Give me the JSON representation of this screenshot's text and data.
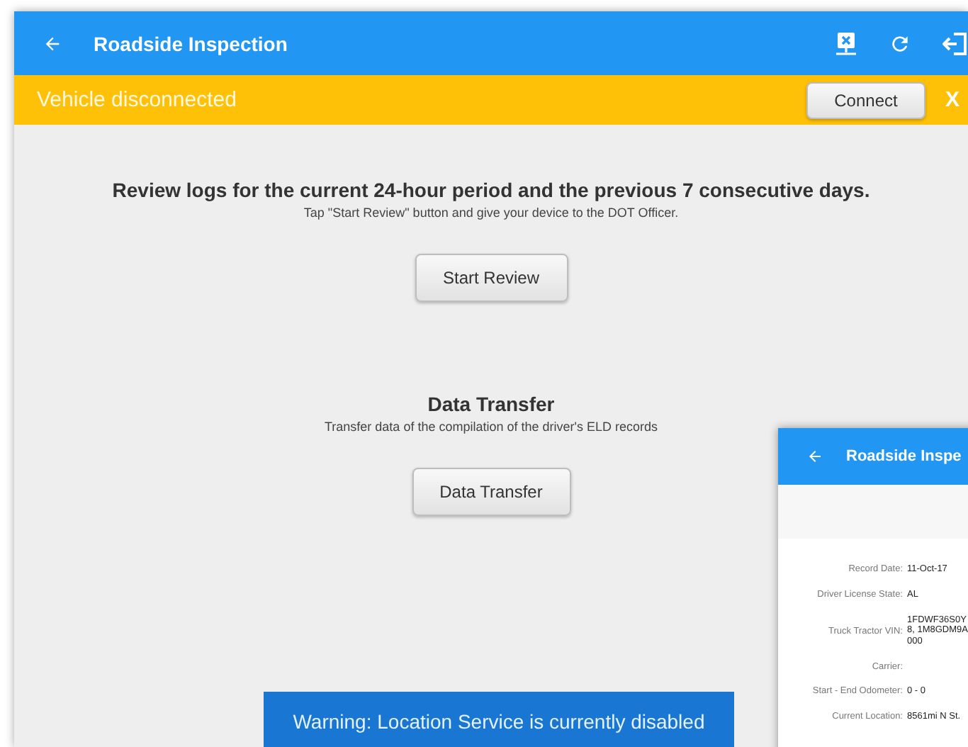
{
  "app_bar": {
    "title": "Roadside Inspection"
  },
  "alert_bar": {
    "message": "Vehicle disconnected",
    "action": "Connect",
    "dismiss": "X"
  },
  "review": {
    "heading": "Review logs for the current 24-hour period and the previous 7 consecutive days.",
    "hint": "Tap \"Start Review\" button and give your device to the DOT Officer.",
    "button": "Start Review"
  },
  "transfer": {
    "heading": "Data Transfer",
    "hint": "Transfer data of the compilation of the driver's ELD records",
    "button": "Data Transfer"
  },
  "toast": "Warning: Location Service is currently disabled",
  "phone": {
    "title": "Roadside Inspe",
    "fields": [
      {
        "label": "Record Date:",
        "value": "11-Oct-17"
      },
      {
        "label": "Driver License State:",
        "value": "AL"
      },
      {
        "label": "Truck Tractor VIN:",
        "value": "1FDWF36S0Y\n8, 1M8GDM9A\n000"
      },
      {
        "label": "Carrier:"
      },
      {
        "label": "Start - End Odometer:",
        "value": "0 - 0"
      },
      {
        "label": "Current Location:",
        "value": "8561mi N St."
      }
    ]
  }
}
